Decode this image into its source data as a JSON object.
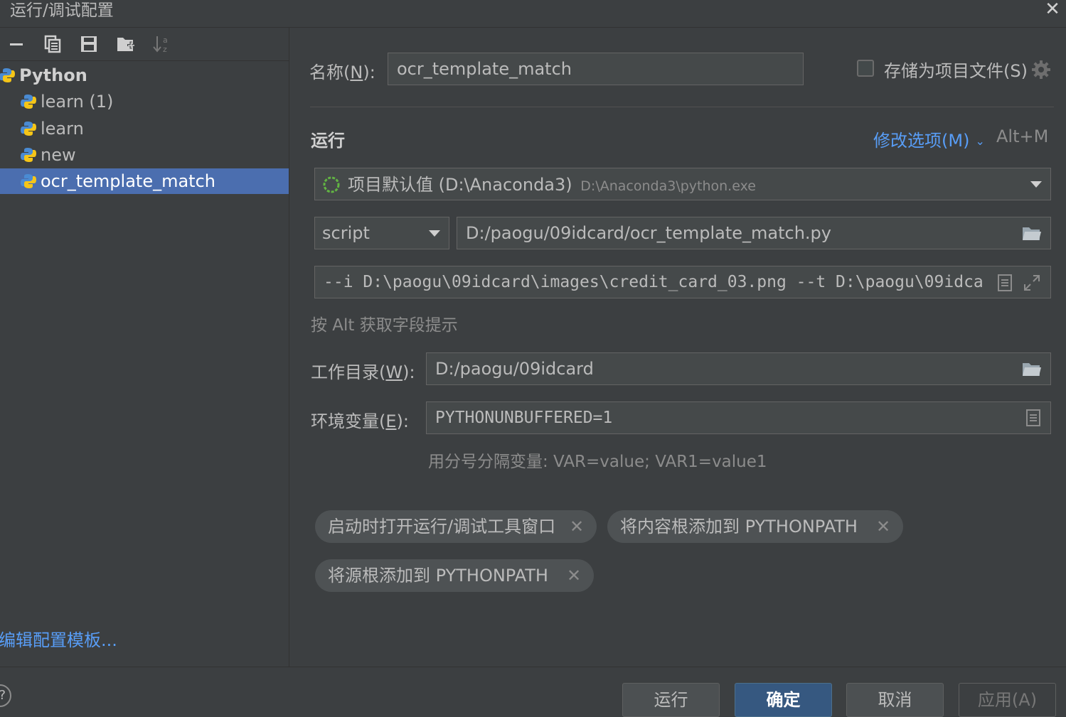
{
  "window": {
    "title": "运行/调试配置",
    "close_icon": "close-icon"
  },
  "toolbar": {
    "icons": [
      "minus-icon",
      "copy-icon",
      "save-icon",
      "new-folder-icon",
      "sort-icon"
    ]
  },
  "tree": {
    "group": "Python",
    "items": [
      {
        "label": "learn (1)"
      },
      {
        "label": "learn"
      },
      {
        "label": "new"
      },
      {
        "label": "ocr_template_match",
        "selected": true
      }
    ]
  },
  "edit_templates_link": "编辑配置模板...",
  "form": {
    "name_label_pre": "名称(",
    "name_label_key": "N",
    "name_label_post": "):",
    "name_value": "ocr_template_match",
    "store_checkbox_label": "存储为项目文件(S)",
    "store_checked": false,
    "run_section_title": "运行",
    "modify_options_label": "修改选项(M)",
    "modify_options_shortcut": "Alt+M",
    "interpreter_name": "项目默认值 (D:\\Anaconda3)",
    "interpreter_path": "D:\\Anaconda3\\python.exe",
    "script_type": "script",
    "script_path": "D:/paogu/09idcard/ocr_template_match.py",
    "parameters": "--i D:\\paogu\\09idcard\\images\\credit_card_03.png --t D:\\paogu\\09idca",
    "parameters_hint": "按 Alt 获取字段提示",
    "workdir_label_pre": "工作目录(",
    "workdir_label_key": "W",
    "workdir_label_post": "):",
    "workdir_value": "D:/paogu/09idcard",
    "env_label_pre": "环境变量(",
    "env_label_key": "E",
    "env_label_post": "):",
    "env_value": "PYTHONUNBUFFERED=1",
    "env_hint": "用分号分隔变量: VAR=value; VAR1=value1",
    "tags": [
      {
        "label": "启动时打开运行/调试工具窗口"
      },
      {
        "label": "将内容根添加到 PYTHONPATH"
      },
      {
        "label": "将源根添加到 PYTHONPATH"
      }
    ]
  },
  "buttons": {
    "run": "运行",
    "ok": "确定",
    "cancel": "取消",
    "apply": "应用(A)"
  },
  "colors": {
    "accent": "#589df6",
    "selection": "#4b6eaf",
    "primary_button": "#365880"
  }
}
